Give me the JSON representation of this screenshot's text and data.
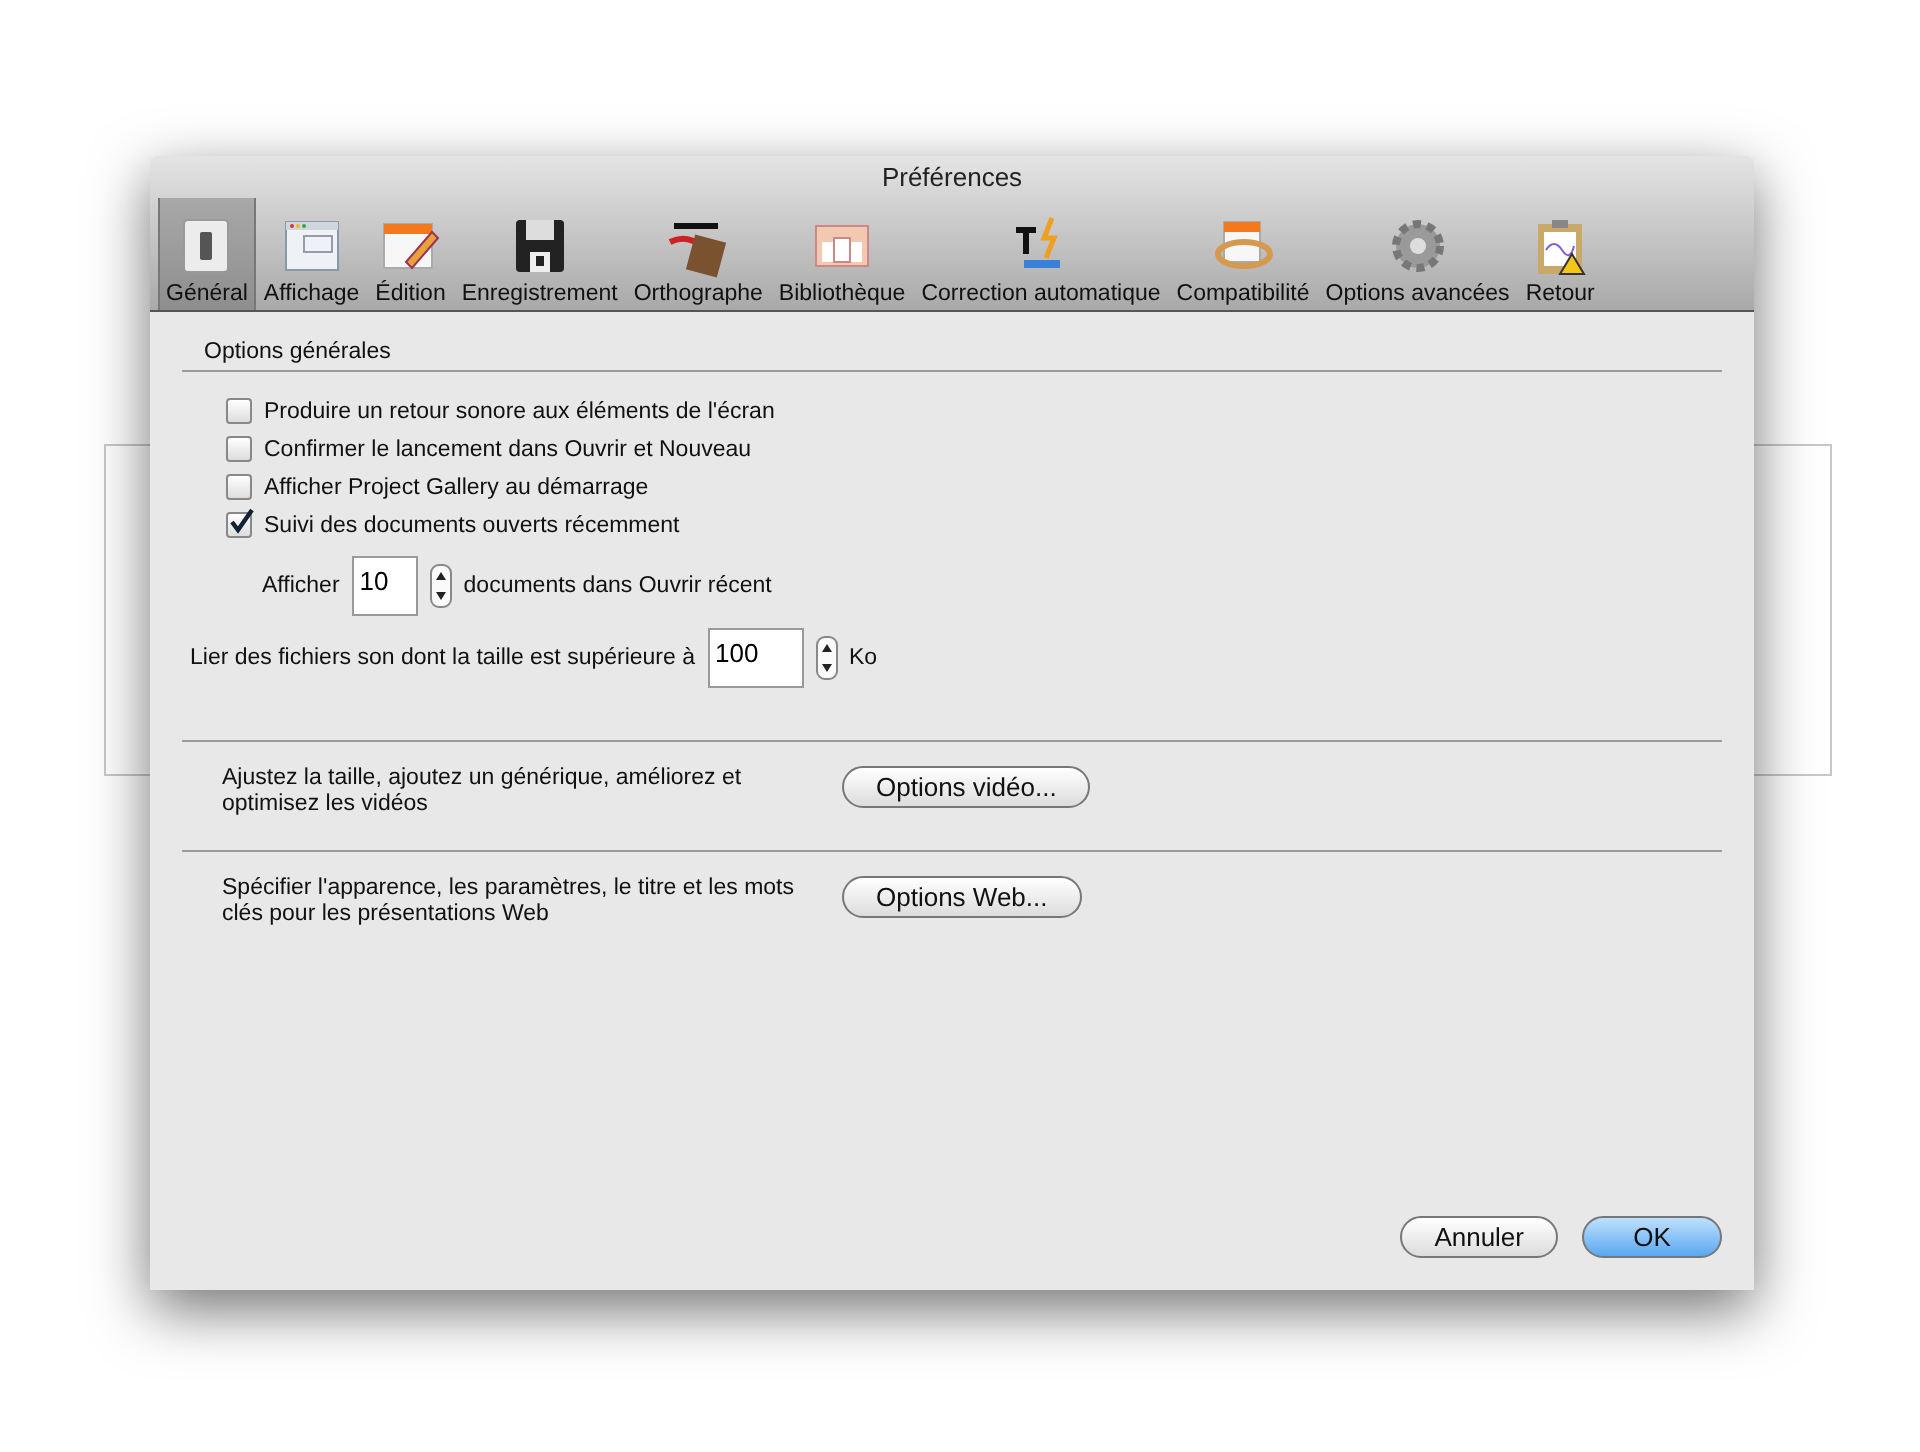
{
  "window": {
    "title": "Préférences"
  },
  "toolbar": [
    {
      "label": "Général",
      "selected": true
    },
    {
      "label": "Affichage",
      "selected": false
    },
    {
      "label": "Édition",
      "selected": false
    },
    {
      "label": "Enregistrement",
      "selected": false
    },
    {
      "label": "Orthographe",
      "selected": false
    },
    {
      "label": "Bibliothèque",
      "selected": false
    },
    {
      "label": "Correction automatique",
      "selected": false
    },
    {
      "label": "Compatibilité",
      "selected": false
    },
    {
      "label": "Options avancées",
      "selected": false
    },
    {
      "label": "Retour",
      "selected": false
    }
  ],
  "general": {
    "heading": "Options générales",
    "checkboxes": [
      {
        "label": "Produire un retour sonore aux éléments de l'écran",
        "checked": false
      },
      {
        "label": "Confirmer le lancement dans Ouvrir et Nouveau",
        "checked": false
      },
      {
        "label": "Afficher Project Gallery au démarrage",
        "checked": false
      },
      {
        "label": "Suivi des documents ouverts récemment",
        "checked": true
      }
    ],
    "recent": {
      "prefix": "Afficher",
      "value": "10",
      "suffix": "documents dans Ouvrir récent"
    },
    "sound": {
      "prefix": "Lier des fichiers son dont la taille est supérieure à",
      "value": "100",
      "suffix": "Ko"
    }
  },
  "sections": [
    {
      "text": "Ajustez la taille, ajoutez un générique, améliorez et optimisez les vidéos",
      "button": "Options vidéo..."
    },
    {
      "text": "Spécifier l'apparence, les paramètres, le titre et les mots clés pour les présentations Web",
      "button": "Options Web..."
    }
  ],
  "buttons": [
    {
      "label": "Annuler",
      "default": false
    },
    {
      "label": "OK",
      "default": true
    }
  ]
}
